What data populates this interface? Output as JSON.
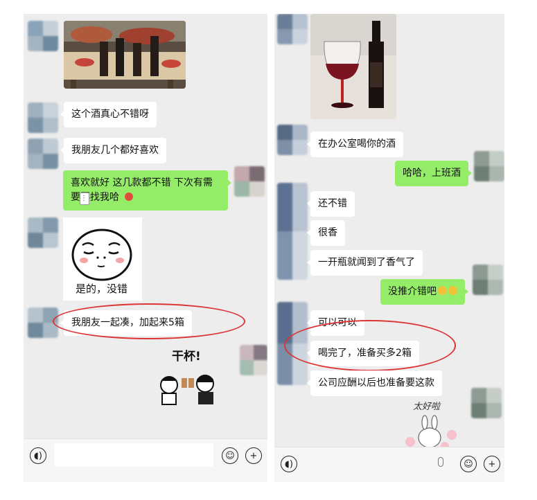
{
  "left_chat": {
    "messages": [
      {
        "type": "image",
        "desc": "wine bottles on picnic table"
      },
      {
        "type": "text",
        "side": "in",
        "text": "这个酒真心不错呀"
      },
      {
        "type": "text",
        "side": "in",
        "text": "我朋友几个都好喜欢"
      },
      {
        "type": "text",
        "side": "out",
        "line1": "喜欢就好  这几款都不错 下次有需",
        "line2": "要再找我哈"
      },
      {
        "type": "sticker",
        "caption": "是的，没错"
      },
      {
        "type": "text",
        "side": "in",
        "text": "我朋友一起凑，加起来5箱"
      },
      {
        "type": "sticker",
        "caption": "干杯!"
      }
    ]
  },
  "right_chat": {
    "messages": [
      {
        "type": "image",
        "desc": "wine glass and bottle"
      },
      {
        "type": "text",
        "side": "in",
        "text": "在办公室喝你的酒"
      },
      {
        "type": "text",
        "side": "out",
        "text": "哈哈，上班酒"
      },
      {
        "type": "text",
        "side": "in",
        "text": "还不错"
      },
      {
        "type": "text",
        "side": "in",
        "text": "很香"
      },
      {
        "type": "text",
        "side": "in",
        "text": "一开瓶就闻到了香气了"
      },
      {
        "type": "text",
        "side": "out",
        "text": "没推介错吧"
      },
      {
        "type": "text",
        "side": "in",
        "text": "可以可以"
      },
      {
        "type": "text",
        "side": "in",
        "text": "喝完了，准备买多2箱"
      },
      {
        "type": "text",
        "side": "in",
        "text": "公司应酬以后也准备要这款"
      },
      {
        "type": "sticker",
        "caption": "太好啦"
      }
    ]
  },
  "icons": [
    "voice-icon",
    "emoji-icon",
    "plus-icon",
    "mic-icon"
  ],
  "colors": {
    "chat_bg": "#ededed",
    "outgoing_bubble": "#95ec69",
    "incoming_bubble": "#ffffff",
    "annotation": "#dd3333"
  }
}
